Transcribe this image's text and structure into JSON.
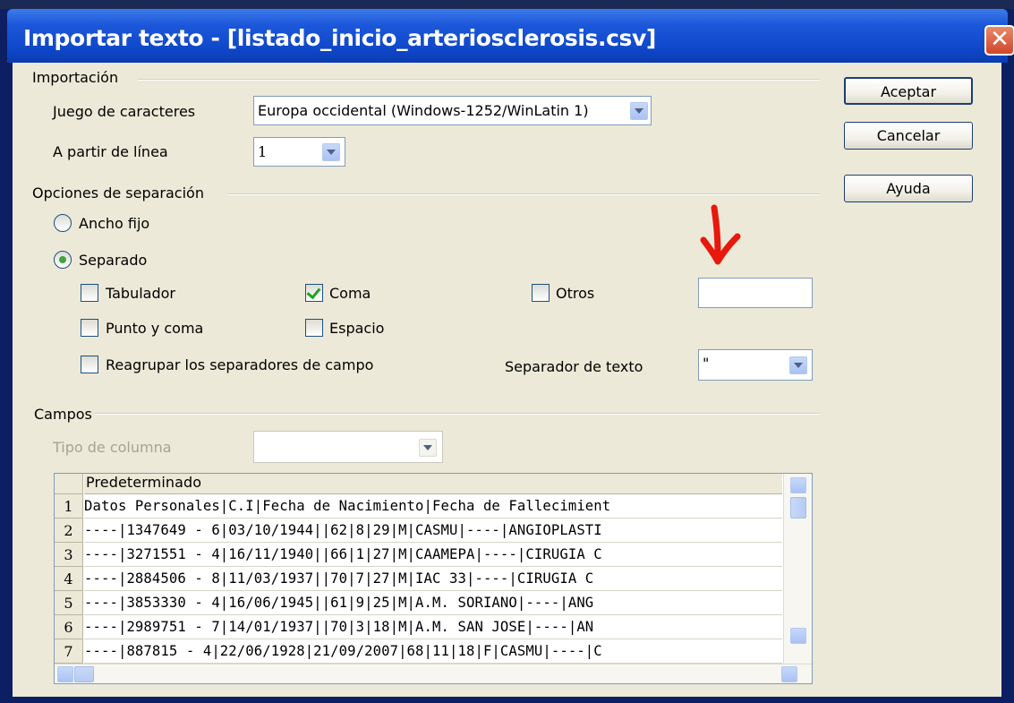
{
  "window": {
    "title": "Importar texto - [listado_inicio_arteriosclerosis.csv]",
    "close_glyph": "✕"
  },
  "buttons": {
    "ok": "Aceptar",
    "cancel": "Cancelar",
    "help": "Ayuda"
  },
  "import": {
    "group_label": "Importación",
    "charset_label": "Juego de caracteres",
    "charset_value": "Europa occidental (Windows-1252/WinLatin 1)",
    "from_line_label": "A partir de línea",
    "from_line_value": "1"
  },
  "separation": {
    "group_label": "Opciones de separación",
    "fixed_width_label": "Ancho fijo",
    "separated_label": "Separado",
    "separated_selected": true,
    "tab_label": "Tabulador",
    "tab_checked": false,
    "comma_label": "Coma",
    "comma_checked": true,
    "other_label": "Otros",
    "other_checked": false,
    "other_value": "",
    "semicolon_label": "Punto y coma",
    "semicolon_checked": false,
    "space_label": "Espacio",
    "space_checked": false,
    "merge_label": "Reagrupar los separadores de campo",
    "merge_checked": false,
    "text_delim_label": "Separador de texto",
    "text_delim_value": "\""
  },
  "fields": {
    "group_label": "Campos",
    "column_type_label": "Tipo de columna",
    "column_type_value": "",
    "header": "Predeterminado",
    "rows": [
      {
        "n": "1",
        "text": "Datos Personales|C.I|Fecha de Nacimiento|Fecha de Fallecimient"
      },
      {
        "n": "2",
        "text": " ----|1347649 - 6|03/10/1944||62|8|29|M|CASMU|----|ANGIOPLASTI"
      },
      {
        "n": "3",
        "text": " ----|3271551 - 4|16/11/1940||66|1|27|M|CAAMEPA|----|CIRUGIA C"
      },
      {
        "n": "4",
        "text": " ----|2884506 - 8|11/03/1937||70|7|27|M|IAC  33|----|CIRUGIA C"
      },
      {
        "n": "5",
        "text": " ----|3853330 - 4|16/06/1945||61|9|25|M|A.M.  SORIANO|----|ANG"
      },
      {
        "n": "6",
        "text": " ----|2989751 - 7|14/01/1937||70|3|18|M|A.M.  SAN JOSE|----|AN"
      },
      {
        "n": "7",
        "text": " ----|887815 - 4|22/06/1928|21/09/2007|68|11|18|F|CASMU|----|C"
      }
    ]
  },
  "annotation": {
    "arrow_color": "#e8180c"
  }
}
